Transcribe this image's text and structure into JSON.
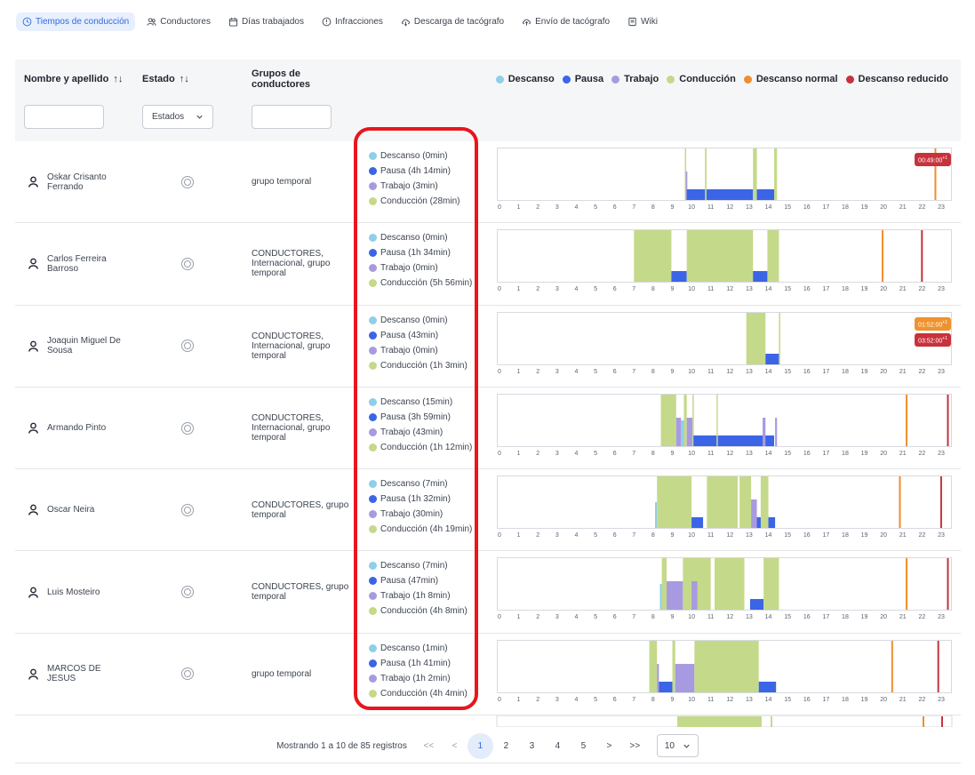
{
  "tabs": [
    {
      "label": "Tiempos de conducción",
      "icon": "clock-icon",
      "active": true
    },
    {
      "label": "Conductores",
      "icon": "users-icon",
      "active": false
    },
    {
      "label": "Días trabajados",
      "icon": "calendar-icon",
      "active": false
    },
    {
      "label": "Infracciones",
      "icon": "alert-circle-icon",
      "active": false
    },
    {
      "label": "Descarga de tacógrafo",
      "icon": "cloud-download-icon",
      "active": false
    },
    {
      "label": "Envío de tacógrafo",
      "icon": "cloud-upload-icon",
      "active": false
    },
    {
      "label": "Wiki",
      "icon": "book-icon",
      "active": false
    }
  ],
  "table": {
    "headers": {
      "name": "Nombre y apellido",
      "state": "Estado",
      "groups": "Grupos de conductores",
      "sort_icon": "↑↓"
    },
    "filters": {
      "name_value": "",
      "state_value": "Estados",
      "group_value": ""
    }
  },
  "legend": [
    {
      "label": "Descanso",
      "color": "#8fcfe8"
    },
    {
      "label": "Pausa",
      "color": "#3b64e6"
    },
    {
      "label": "Trabajo",
      "color": "#a89ae0"
    },
    {
      "label": "Conducción",
      "color": "#c5d98a"
    },
    {
      "label": "Descanso normal",
      "color": "#ef8f2f"
    },
    {
      "label": "Descanso reducido",
      "color": "#c8323c"
    }
  ],
  "colors": {
    "descanso": "#8fcfe8",
    "pausa": "#3b64e6",
    "trabajo": "#a89ae0",
    "conduccion": "#c5d98a",
    "normal": "#ef8f2f",
    "reducido": "#c8323c"
  },
  "hours": [
    "0",
    "1",
    "2",
    "3",
    "4",
    "5",
    "6",
    "7",
    "8",
    "9",
    "10",
    "11",
    "12",
    "13",
    "14",
    "15",
    "16",
    "17",
    "18",
    "19",
    "20",
    "21",
    "22",
    "23"
  ],
  "rows": [
    {
      "name": "Oskar Crisanto Ferrando",
      "group": "grupo temporal",
      "summary": [
        "Descanso (0min)",
        "Pausa (4h 14min)",
        "Trabajo (3min)",
        "Conducción (28min)"
      ],
      "activities": [
        {
          "t": "conduccion",
          "s": 9.65,
          "e": 9.72
        },
        {
          "t": "trabajo",
          "s": 9.7,
          "e": 9.78
        },
        {
          "t": "pausa",
          "s": 9.75,
          "e": 13.2
        },
        {
          "t": "conduccion",
          "s": 10.7,
          "e": 10.78
        },
        {
          "t": "conduccion",
          "s": 13.2,
          "e": 13.4
        },
        {
          "t": "pausa",
          "s": 13.4,
          "e": 14.3
        },
        {
          "t": "conduccion",
          "s": 14.3,
          "e": 14.45
        }
      ],
      "markers": [
        {
          "t": "normal",
          "h": 22.65
        }
      ],
      "badges": [
        {
          "text": "00:49:00",
          "sup": "+1",
          "color": "red"
        }
      ]
    },
    {
      "name": "Carlos Ferreira Barroso",
      "group": "CONDUCTORES, Internacional, grupo temporal",
      "summary": [
        "Descanso (0min)",
        "Pausa (1h 34min)",
        "Trabajo (0min)",
        "Conducción (5h 56min)"
      ],
      "activities": [
        {
          "t": "conduccion",
          "s": 7.0,
          "e": 8.95
        },
        {
          "t": "pausa",
          "s": 8.95,
          "e": 9.75
        },
        {
          "t": "conduccion",
          "s": 9.75,
          "e": 13.2
        },
        {
          "t": "pausa",
          "s": 13.2,
          "e": 13.95
        },
        {
          "t": "conduccion",
          "s": 13.95,
          "e": 14.55
        }
      ],
      "markers": [
        {
          "t": "normal",
          "h": 19.9
        },
        {
          "t": "reducido",
          "h": 21.95
        }
      ],
      "badges": []
    },
    {
      "name": "Joaquin Miguel De Sousa",
      "group": "CONDUCTORES, Internacional, grupo temporal",
      "summary": [
        "Descanso (0min)",
        "Pausa (43min)",
        "Trabajo (0min)",
        "Conducción (1h 3min)"
      ],
      "activities": [
        {
          "t": "conduccion",
          "s": 12.85,
          "e": 13.85
        },
        {
          "t": "pausa",
          "s": 13.85,
          "e": 14.55
        },
        {
          "t": "conduccion",
          "s": 14.55,
          "e": 14.6
        }
      ],
      "markers": [],
      "badges": [
        {
          "text": "01:52:00",
          "sup": "+1",
          "color": "orange"
        },
        {
          "text": "03:52:00",
          "sup": "+1",
          "color": "red"
        }
      ]
    },
    {
      "name": "Armando Pinto",
      "group": "CONDUCTORES, Internacional, grupo temporal",
      "summary": [
        "Descanso (15min)",
        "Pausa (3h 59min)",
        "Trabajo (43min)",
        "Conducción (1h 12min)"
      ],
      "activities": [
        {
          "t": "conduccion",
          "s": 8.4,
          "e": 9.2
        },
        {
          "t": "trabajo",
          "s": 9.2,
          "e": 9.45
        },
        {
          "t": "descanso",
          "s": 9.45,
          "e": 9.6
        },
        {
          "t": "conduccion",
          "s": 9.6,
          "e": 9.75
        },
        {
          "t": "trabajo",
          "s": 9.75,
          "e": 10.05
        },
        {
          "t": "conduccion",
          "s": 10.05,
          "e": 10.1
        },
        {
          "t": "pausa",
          "s": 10.1,
          "e": 14.3
        },
        {
          "t": "conduccion",
          "s": 11.3,
          "e": 11.35
        },
        {
          "t": "trabajo",
          "s": 13.7,
          "e": 13.85
        },
        {
          "t": "trabajo",
          "s": 14.35,
          "e": 14.45
        }
      ],
      "markers": [
        {
          "t": "normal",
          "h": 21.15
        },
        {
          "t": "reducido",
          "h": 23.3
        }
      ],
      "badges": []
    },
    {
      "name": "Oscar Neira",
      "group": "CONDUCTORES, grupo temporal",
      "summary": [
        "Descanso (7min)",
        "Pausa (1h 32min)",
        "Trabajo (30min)",
        "Conducción (4h 19min)"
      ],
      "activities": [
        {
          "t": "descanso",
          "s": 8.1,
          "e": 8.2
        },
        {
          "t": "conduccion",
          "s": 8.2,
          "e": 10.0
        },
        {
          "t": "pausa",
          "s": 10.0,
          "e": 10.6
        },
        {
          "t": "conduccion",
          "s": 10.8,
          "e": 12.4
        },
        {
          "t": "conduccion",
          "s": 12.5,
          "e": 13.1
        },
        {
          "t": "trabajo",
          "s": 13.1,
          "e": 13.4
        },
        {
          "t": "pausa",
          "s": 13.4,
          "e": 14.35
        },
        {
          "t": "conduccion",
          "s": 13.6,
          "e": 14.0
        }
      ],
      "markers": [
        {
          "t": "normal",
          "h": 20.8
        },
        {
          "t": "reducido",
          "h": 22.95
        }
      ],
      "badges": []
    },
    {
      "name": "Luis Mosteiro",
      "group": "CONDUCTORES, grupo temporal",
      "summary": [
        "Descanso (7min)",
        "Pausa (47min)",
        "Trabajo (1h 8min)",
        "Conducción (4h 8min)"
      ],
      "activities": [
        {
          "t": "descanso",
          "s": 8.35,
          "e": 8.45
        },
        {
          "t": "conduccion",
          "s": 8.45,
          "e": 8.7
        },
        {
          "t": "trabajo",
          "s": 8.7,
          "e": 9.55
        },
        {
          "t": "conduccion",
          "s": 9.55,
          "e": 11.0
        },
        {
          "t": "trabajo",
          "s": 10.0,
          "e": 10.3
        },
        {
          "t": "conduccion",
          "s": 11.2,
          "e": 12.75
        },
        {
          "t": "pausa",
          "s": 13.05,
          "e": 13.75
        },
        {
          "t": "conduccion",
          "s": 13.75,
          "e": 14.55
        }
      ],
      "markers": [
        {
          "t": "normal",
          "h": 21.15
        },
        {
          "t": "reducido",
          "h": 23.3
        }
      ],
      "badges": []
    },
    {
      "name": "MARCOS DE JESUS",
      "group": "grupo temporal",
      "summary": [
        "Descanso (1min)",
        "Pausa (1h 41min)",
        "Trabajo (1h 2min)",
        "Conducción (4h 4min)"
      ],
      "activities": [
        {
          "t": "conduccion",
          "s": 7.8,
          "e": 8.2
        },
        {
          "t": "trabajo",
          "s": 8.2,
          "e": 8.3
        },
        {
          "t": "pausa",
          "s": 8.3,
          "e": 9.0
        },
        {
          "t": "conduccion",
          "s": 9.0,
          "e": 9.15
        },
        {
          "t": "trabajo",
          "s": 9.15,
          "e": 10.15
        },
        {
          "t": "conduccion",
          "s": 10.15,
          "e": 13.5
        },
        {
          "t": "pausa",
          "s": 13.5,
          "e": 14.4
        }
      ],
      "markers": [
        {
          "t": "normal",
          "h": 20.4
        },
        {
          "t": "reducido",
          "h": 22.8
        }
      ],
      "badges": []
    }
  ],
  "pagination": {
    "info": "Mostrando 1 a 10 de 85 registros",
    "first": "<<",
    "prev": "<",
    "pages": [
      "1",
      "2",
      "3",
      "4",
      "5"
    ],
    "active_page": "1",
    "next": ">",
    "last": ">>",
    "page_size": "10"
  }
}
